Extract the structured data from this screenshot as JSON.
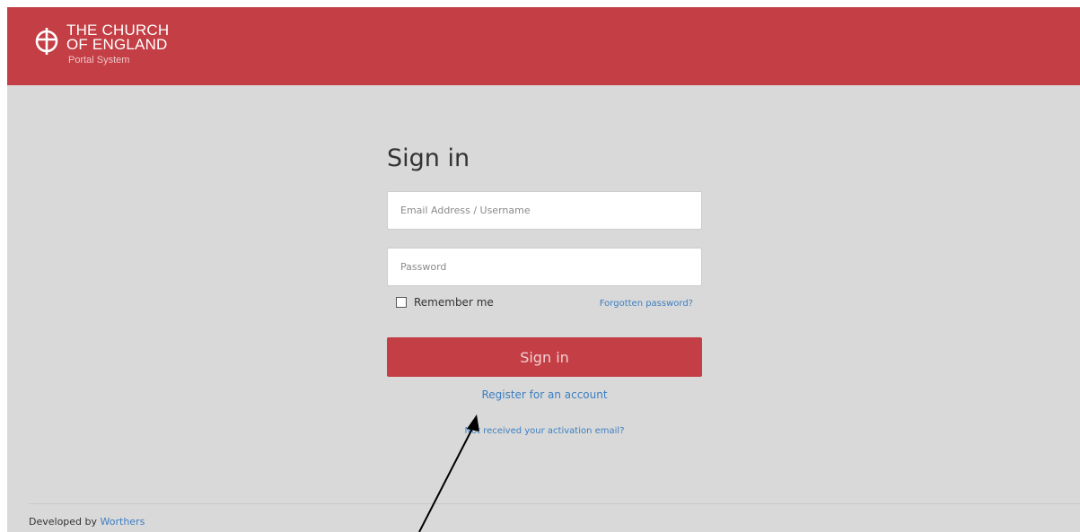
{
  "header": {
    "logo_line1": "THE CHURCH",
    "logo_line2": "OF ENGLAND",
    "subtitle": "Portal System",
    "background_color": "#c33f45"
  },
  "form": {
    "title": "Sign in",
    "email_placeholder": "Email Address / Username",
    "password_placeholder": "Password",
    "remember_label": "Remember me",
    "remember_checked": false,
    "forgot_link": "Forgotten password?",
    "submit_label": "Sign in",
    "register_link": "Register for an account",
    "activation_link": "Not received your activation email?"
  },
  "footer": {
    "developed_by": "Developed by",
    "developer_link": "Worthers"
  },
  "colors": {
    "accent": "#c33f45",
    "link": "#3d7fc1",
    "page_background": "#d9d9d9"
  }
}
